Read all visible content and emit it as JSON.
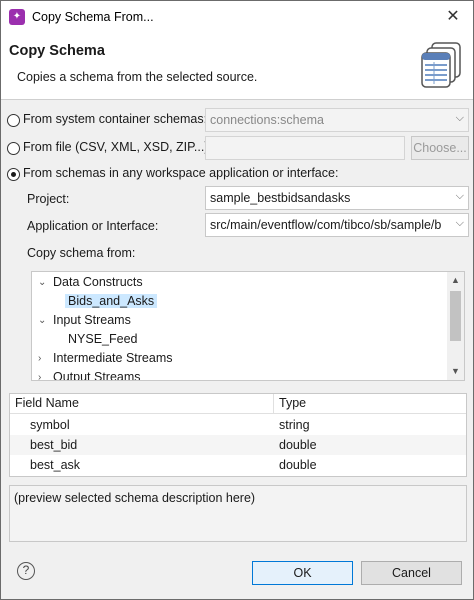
{
  "window": {
    "title": "Copy Schema From...",
    "close_glyph": "✕"
  },
  "header": {
    "title": "Copy Schema",
    "description": "Copies a schema from the selected source."
  },
  "sources": {
    "system": {
      "label": "From system container schemas:",
      "selected": false,
      "value": "connections:schema",
      "enabled": false
    },
    "file": {
      "label": "From file (CSV, XML, XSD, ZIP...):",
      "selected": false,
      "value": "",
      "browse_label": "Choose...",
      "enabled": false
    },
    "workspace": {
      "label": "From schemas in any workspace application or interface:",
      "selected": true
    }
  },
  "project": {
    "label": "Project:",
    "value": "sample_bestbidsandasks"
  },
  "application": {
    "label": "Application or Interface:",
    "value": "src/main/eventflow/com/tibco/sb/sample/b"
  },
  "copy_from_label": "Copy schema from:",
  "tree": [
    {
      "label": "Data Constructs",
      "expanded": true,
      "level": 0
    },
    {
      "label": "Bids_and_Asks",
      "level": 1,
      "selected": true
    },
    {
      "label": "Input Streams",
      "expanded": true,
      "level": 0
    },
    {
      "label": "NYSE_Feed",
      "level": 1
    },
    {
      "label": "Intermediate Streams",
      "expanded": false,
      "level": 0
    },
    {
      "label": "Output Streams",
      "expanded": false,
      "level": 0
    }
  ],
  "fields_table": {
    "columns": [
      "Field Name",
      "Type"
    ],
    "rows": [
      {
        "name": "symbol",
        "type": "string"
      },
      {
        "name": "best_bid",
        "type": "double"
      },
      {
        "name": "best_ask",
        "type": "double"
      }
    ]
  },
  "preview": {
    "text": "(preview selected schema description here)"
  },
  "footer": {
    "help_glyph": "?",
    "ok_label": "OK",
    "cancel_label": "Cancel"
  },
  "colors": {
    "accent": "#0078d7",
    "selection": "#cce8ff",
    "app_icon": "#9b2fae"
  }
}
